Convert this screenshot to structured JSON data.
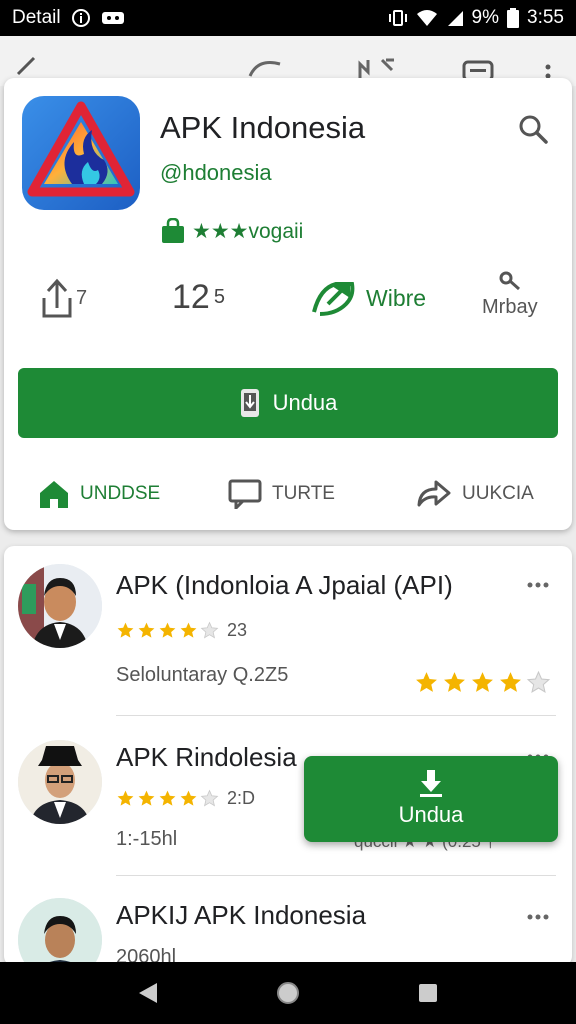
{
  "status": {
    "left_label": "Detail",
    "battery_text": "9%",
    "time": "3:55"
  },
  "app": {
    "title": "APK Indonesia",
    "developer": "@hdonesia",
    "rating_text": "★★★vogaii",
    "stats": {
      "share_count": "7",
      "count_main": "12",
      "count_small": "5",
      "wibre_label": "Wibre",
      "mrbay_label": "Mrbay"
    },
    "install_label": "Undua"
  },
  "tabs": [
    {
      "label": "UNDDSE",
      "icon": "home-icon"
    },
    {
      "label": "TURTE",
      "icon": "chat-icon"
    },
    {
      "label": "UUKCIA",
      "icon": "share-icon"
    }
  ],
  "list": [
    {
      "title": "APK (Indonloia A Jpaial (API)",
      "stars": 4,
      "rating_text": "23",
      "subtitle": "Seloluntaray Q.2Z5",
      "right_stars": 4
    },
    {
      "title": "APK Rindolesia",
      "stars": 4,
      "rating_text": "2:D",
      "subtitle": "1:-15hl",
      "subtitle_right": "quccil ★ ★ (0.25 †"
    },
    {
      "title": "APKIJ APK Indonesia",
      "subtitle": "2060hl"
    }
  ],
  "float_button": {
    "label": "Undua"
  },
  "colors": {
    "accent": "#1e8a36",
    "star": "#f4b400",
    "status_bar": "#000000"
  }
}
